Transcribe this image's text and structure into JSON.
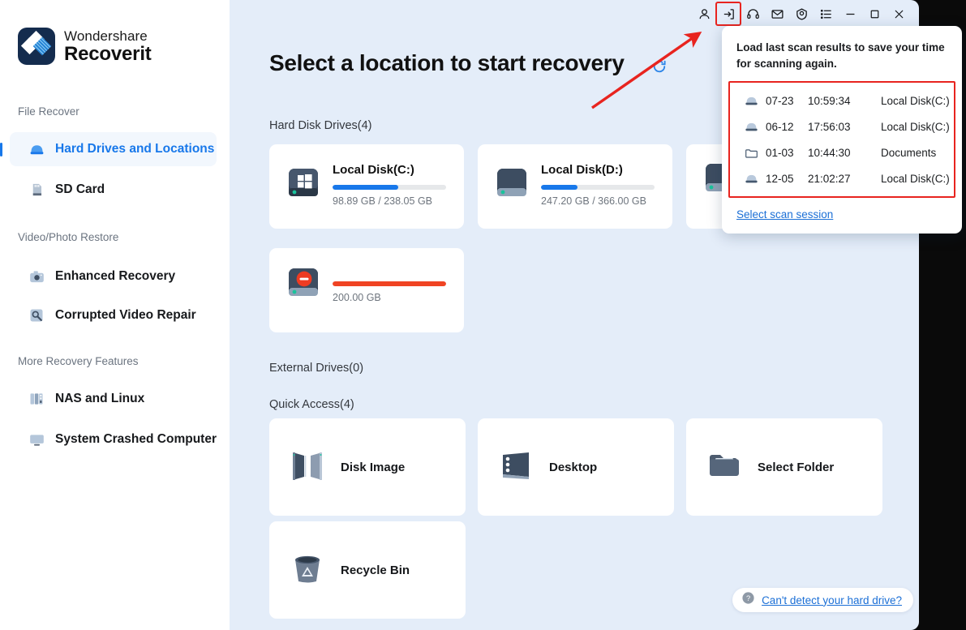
{
  "brand": {
    "top": "Wondershare",
    "bottom": "Recoverit"
  },
  "sidebar": {
    "groups": [
      {
        "label": "File Recover",
        "items": [
          {
            "label": "Hard Drives and Locations",
            "icon": "hard-drive-icon",
            "active": true
          },
          {
            "label": "SD Card",
            "icon": "sd-card-icon",
            "active": false
          }
        ]
      },
      {
        "label": "Video/Photo Restore",
        "items": [
          {
            "label": "Enhanced Recovery",
            "icon": "camera-icon",
            "active": false
          },
          {
            "label": "Corrupted Video Repair",
            "icon": "wrench-search-icon",
            "active": false
          }
        ]
      },
      {
        "label": "More Recovery Features",
        "items": [
          {
            "label": "NAS and Linux",
            "icon": "server-icon",
            "active": false
          },
          {
            "label": "System Crashed Computer",
            "icon": "monitor-icon",
            "active": false
          }
        ]
      }
    ]
  },
  "titlebar": {
    "buttons": [
      {
        "name": "account-icon",
        "title": "Account"
      },
      {
        "name": "import-scan-icon",
        "title": "Load last scan results",
        "highlight": true
      },
      {
        "name": "headset-support-icon",
        "title": "Support"
      },
      {
        "name": "mail-icon",
        "title": "Mail"
      },
      {
        "name": "shield-award-icon",
        "title": "Benefits"
      },
      {
        "name": "menu-list-icon",
        "title": "Menu"
      },
      {
        "name": "minimize-icon",
        "title": "Minimize"
      },
      {
        "name": "maximize-icon",
        "title": "Maximize"
      },
      {
        "name": "close-icon",
        "title": "Close"
      }
    ]
  },
  "main": {
    "page_title": "Select a location to start recovery",
    "refresh_icon": "refresh-icon",
    "sections": {
      "hard_disk_drives": "Hard Disk Drives(4)",
      "external_drives": "External Drives(0)",
      "quick_access": "Quick Access(4)"
    },
    "drives": [
      {
        "name": "Local Disk(C:)",
        "size": "98.89 GB / 238.05 GB",
        "fill_pct": 58,
        "bar_color": "#1878ea",
        "icon": "windows-disk-icon"
      },
      {
        "name": "Local Disk(D:)",
        "size": "247.20 GB / 366.00 GB",
        "fill_pct": 32,
        "bar_color": "#1878ea",
        "icon": "disk-icon"
      },
      {
        "name": "",
        "size": "",
        "fill_pct": 0,
        "bar_color": "#1878ea",
        "icon": "disk-icon"
      },
      {
        "name": "",
        "size": "200.00 GB",
        "fill_pct": 100,
        "bar_color": "#f04323",
        "icon": "disk-error-icon"
      }
    ],
    "quick_access": [
      {
        "label": "Disk Image",
        "icon": "disk-image-icon"
      },
      {
        "label": "Desktop",
        "icon": "desktop-icon"
      },
      {
        "label": "Select Folder",
        "icon": "folder-icon"
      },
      {
        "label": "Recycle Bin",
        "icon": "recycle-bin-icon"
      }
    ],
    "help": {
      "icon": "question-mark-icon",
      "label": "Can't detect your hard drive?"
    }
  },
  "popover": {
    "headline": "Load last scan results to save your time for scanning again.",
    "rows": [
      {
        "icon": "drive-icon",
        "date": "07-23",
        "time": "10:59:34",
        "target": "Local Disk(C:)"
      },
      {
        "icon": "drive-icon",
        "date": "06-12",
        "time": "17:56:03",
        "target": "Local Disk(C:)"
      },
      {
        "icon": "folder-outline-icon",
        "date": "01-03",
        "time": "10:44:30",
        "target": "Documents"
      },
      {
        "icon": "drive-icon",
        "date": "12-05",
        "time": "21:02:27",
        "target": "Local Disk(C:)"
      }
    ],
    "link": "Select scan session",
    "highlight_color": "#e8241f"
  },
  "annotation": {
    "arrow_color": "#e8241f"
  }
}
